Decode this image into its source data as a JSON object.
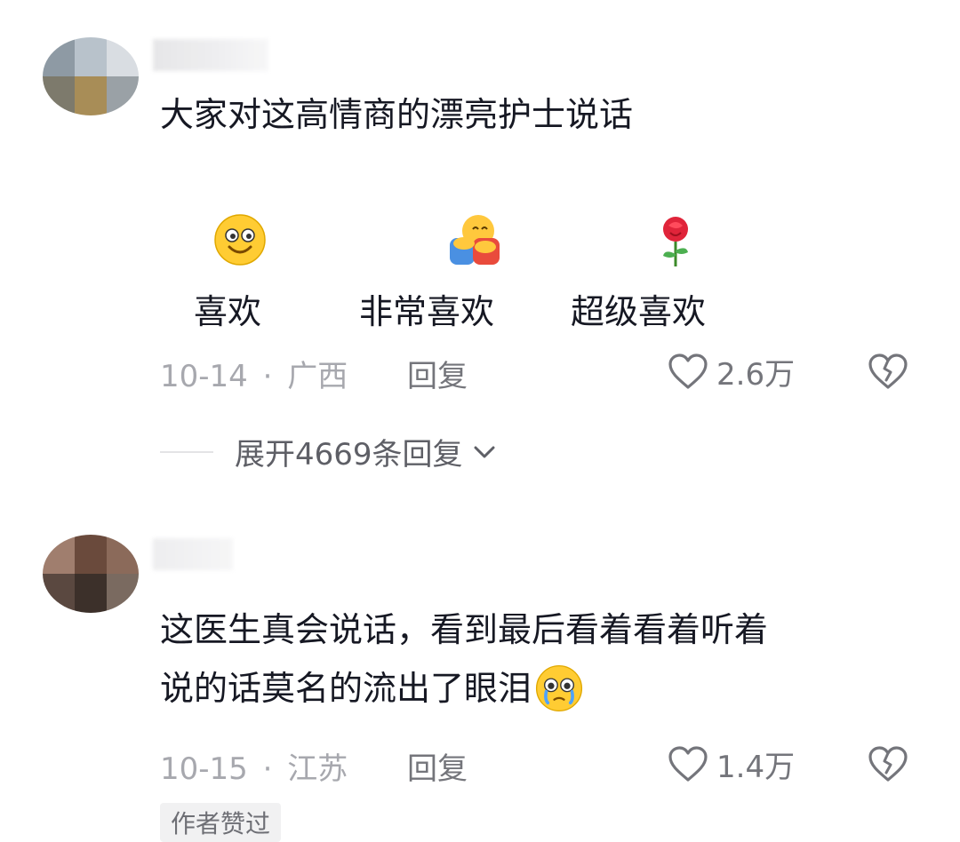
{
  "comments": [
    {
      "text_lines": [
        "大家对这高情商的漂亮护士说话"
      ],
      "reactions": [
        {
          "emoji": "grinning-face-icon",
          "label": "喜欢"
        },
        {
          "emoji": "hugging-face-icon",
          "label": "非常喜欢"
        },
        {
          "emoji": "rose-icon",
          "label": "超级喜欢"
        }
      ],
      "date": "10-14",
      "separator": "·",
      "location": "广西",
      "reply_label": "回复",
      "like_count": "2.6万",
      "expand_replies": "展开4669条回复"
    },
    {
      "text_lines": [
        "这医生真会说话，看到最后看着看着听着",
        "说的话莫名的流出了眼泪"
      ],
      "trailing_emoji": "crying-face-icon",
      "date": "10-15",
      "separator": "·",
      "location": "江苏",
      "reply_label": "回复",
      "like_count": "1.4万",
      "badge": "作者赞过"
    }
  ],
  "colors": {
    "text": "#161823",
    "meta": "#a7a8ae",
    "secondary": "#74757b",
    "badge_bg": "#f1f1f2"
  }
}
